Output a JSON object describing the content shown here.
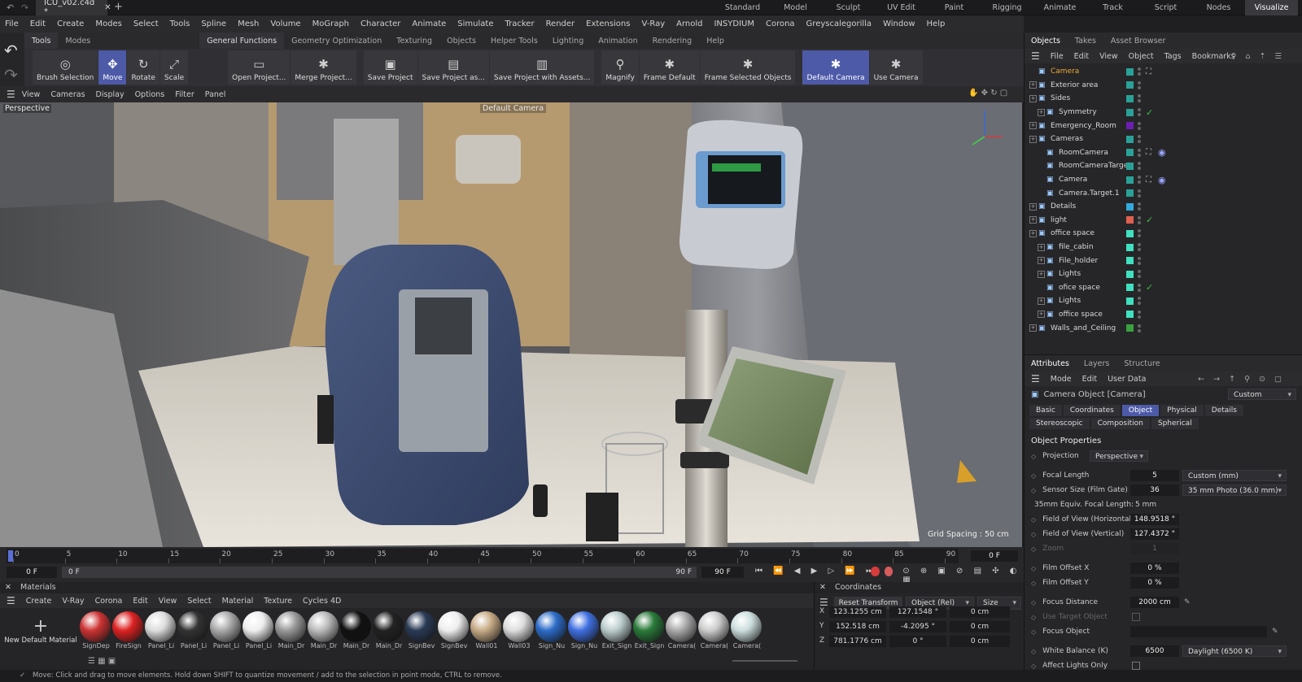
{
  "app": {
    "file_tab": "ICU_v02.c4d *",
    "layouts": [
      "Standard",
      "Model",
      "Sculpt",
      "UV Edit",
      "Paint",
      "Rigging",
      "Animate",
      "Track",
      "Script",
      "Nodes",
      "Visualize"
    ],
    "active_layout": "Visualize"
  },
  "menu": [
    "File",
    "Edit",
    "Create",
    "Modes",
    "Select",
    "Tools",
    "Spline",
    "Mesh",
    "Volume",
    "MoGraph",
    "Character",
    "Animate",
    "Simulate",
    "Tracker",
    "Render",
    "Extensions",
    "V-Ray",
    "Arnold",
    "INSYDIUM",
    "Corona",
    "Greyscalegorilla",
    "Window",
    "Help"
  ],
  "tool_tabs": {
    "left": [
      "Tools",
      "Modes"
    ],
    "right": [
      "General Functions",
      "Geometry Optimization",
      "Texturing",
      "Objects",
      "Helper Tools",
      "Lighting",
      "Animation",
      "Rendering",
      "Help"
    ],
    "active": "General Functions"
  },
  "toolbar": {
    "g1": [
      {
        "label": "Brush Selection",
        "icon": "◎"
      },
      {
        "label": "Move",
        "icon": "✥",
        "sel": true
      },
      {
        "label": "Rotate",
        "icon": "↻"
      },
      {
        "label": "Scale",
        "icon": "⤢"
      }
    ],
    "g2": [
      {
        "label": "Open Project...",
        "icon": "▭"
      },
      {
        "label": "Merge Project...",
        "icon": "✱"
      }
    ],
    "g3": [
      {
        "label": "Save Project",
        "icon": "▣"
      },
      {
        "label": "Save Project as...",
        "icon": "▤"
      },
      {
        "label": "Save Project with Assets...",
        "icon": "▥"
      }
    ],
    "g4": [
      {
        "label": "Magnify",
        "icon": "⚲"
      },
      {
        "label": "Frame Default",
        "icon": "✱"
      },
      {
        "label": "Frame Selected Objects",
        "icon": "✱"
      }
    ],
    "g5": [
      {
        "label": "Default Camera",
        "icon": "✱",
        "sel": true
      },
      {
        "label": "Use Camera",
        "icon": "✱"
      }
    ]
  },
  "viewport": {
    "menu": [
      "View",
      "Cameras",
      "Display",
      "Options",
      "Filter",
      "Panel"
    ],
    "mode": "Perspective",
    "camera": "Default Camera",
    "grid": "Grid Spacing : 50 cm"
  },
  "timeline": {
    "ticks": [
      "0",
      "5",
      "10",
      "15",
      "20",
      "25",
      "30",
      "35",
      "40",
      "45",
      "50",
      "55",
      "60",
      "65",
      "70",
      "75",
      "80",
      "85",
      "90"
    ],
    "current": "0 F",
    "start": "0 F",
    "start2": "0 F",
    "end": "90 F",
    "end2": "90 F"
  },
  "materials": {
    "title": "Materials",
    "menu": [
      "Create",
      "V-Ray",
      "Corona",
      "Edit",
      "View",
      "Select",
      "Material",
      "Texture",
      "Cycles 4D"
    ],
    "new_label": "New Default Material",
    "items": [
      {
        "n": "SignDep",
        "c": "#c33"
      },
      {
        "n": "FireSign",
        "c": "#d22"
      },
      {
        "n": "Panel_Li",
        "c": "#ddd"
      },
      {
        "n": "Panel_Li",
        "c": "#333"
      },
      {
        "n": "Panel_Li",
        "c": "#aaa"
      },
      {
        "n": "Panel_Li",
        "c": "#eee"
      },
      {
        "n": "Main_Dr",
        "c": "#999"
      },
      {
        "n": "Main_Dr",
        "c": "#bbb"
      },
      {
        "n": "Main_Dr",
        "c": "#111"
      },
      {
        "n": "Main_Dr",
        "c": "#222"
      },
      {
        "n": "SignBev",
        "c": "#2a3a55"
      },
      {
        "n": "SignBev",
        "c": "#eee"
      },
      {
        "n": "Wall01",
        "c": "#c7ab86"
      },
      {
        "n": "Wall03",
        "c": "#ddd"
      },
      {
        "n": "Sign_Nu",
        "c": "#2c6cc8"
      },
      {
        "n": "Sign_Nu",
        "c": "#3f6fe0"
      },
      {
        "n": "Exit_Sign",
        "c": "#bcc"
      },
      {
        "n": "Exit_Sign",
        "c": "#2a7a3a"
      },
      {
        "n": "Camera(",
        "c": "#aaa"
      },
      {
        "n": "Camera(",
        "c": "#ccc"
      },
      {
        "n": "Camera(",
        "c": "#cdd"
      }
    ]
  },
  "coords": {
    "title": "Coordinates",
    "reset": "Reset Transform",
    "mode": "Object (Rel)",
    "size": "Size",
    "rows": [
      {
        "axis": "X",
        "pos": "123.1255 cm",
        "rot": "127.1548 °",
        "sz": "0 cm"
      },
      {
        "axis": "Y",
        "pos": "152.518 cm",
        "rot": "-4.2095 °",
        "sz": "0 cm"
      },
      {
        "axis": "Z",
        "pos": "781.1776 cm",
        "rot": "0 °",
        "sz": "0 cm"
      }
    ]
  },
  "status": "Move: Click and drag to move elements. Hold down SHIFT to quantize movement / add to the selection in point mode, CTRL to remove.",
  "objects": {
    "tabs": [
      "Objects",
      "Takes",
      "Asset Browser"
    ],
    "menu": [
      "File",
      "Edit",
      "View",
      "Object",
      "Tags",
      "Bookmarks"
    ],
    "rows": [
      {
        "n": "Camera",
        "d": 0,
        "c": "#2aa198",
        "hl": true,
        "exp": false
      },
      {
        "n": "Exterior area",
        "d": 0,
        "c": "#2aa198",
        "exp": true
      },
      {
        "n": "Sides",
        "d": 0,
        "c": "#2aa198",
        "exp": true
      },
      {
        "n": "Symmetry",
        "d": 1,
        "c": "#2aa198",
        "exp": true,
        "check": true
      },
      {
        "n": "Emergency_Room",
        "d": 0,
        "c": "#6a1fb0",
        "exp": true
      },
      {
        "n": "Cameras",
        "d": 0,
        "c": "#2aa198",
        "exp": true
      },
      {
        "n": "RoomCamera",
        "d": 1,
        "c": "#2aa198",
        "target": true
      },
      {
        "n": "RoomCameraTarget",
        "d": 1,
        "c": "#2aa198"
      },
      {
        "n": "Camera",
        "d": 1,
        "c": "#2aa198",
        "target": true
      },
      {
        "n": "Camera.Target.1",
        "d": 1,
        "c": "#2aa198"
      },
      {
        "n": "Details",
        "d": 0,
        "c": "#33aadd",
        "exp": true
      },
      {
        "n": "light",
        "d": 0,
        "c": "#e06050",
        "exp": true,
        "check": true
      },
      {
        "n": "office space",
        "d": 0,
        "c": "#40e0c0",
        "exp": true
      },
      {
        "n": "file_cabin",
        "d": 1,
        "c": "#40e0c0",
        "exp": true
      },
      {
        "n": "File_holder",
        "d": 1,
        "c": "#40e0c0",
        "exp": true
      },
      {
        "n": "Lights",
        "d": 1,
        "c": "#40e0c0",
        "exp": true
      },
      {
        "n": "ofice space",
        "d": 1,
        "c": "#40e0c0",
        "check": true
      },
      {
        "n": "Lights",
        "d": 1,
        "c": "#40e0c0",
        "exp": true
      },
      {
        "n": "office space",
        "d": 1,
        "c": "#40e0c0",
        "exp": true
      },
      {
        "n": "Walls_and_Ceiling",
        "d": 0,
        "c": "#3aa040",
        "exp": true
      }
    ]
  },
  "attrs": {
    "tabs": [
      "Attributes",
      "Layers",
      "Structure"
    ],
    "menu": [
      "Mode",
      "Edit",
      "User Data"
    ],
    "object": "Camera Object [Camera]",
    "preset": "Custom",
    "btabs": [
      "Basic",
      "Coordinates",
      "Object",
      "Physical",
      "Details",
      "Stereoscopic",
      "Composition",
      "Spherical"
    ],
    "active_btab": "Object",
    "section": "Object Properties",
    "projection_label": "Projection",
    "projection": "Perspective",
    "focal_label": "Focal Length",
    "focal": "5",
    "focal_unit": "Custom (mm)",
    "sensor_label": "Sensor Size (Film Gate)",
    "sensor": "36",
    "sensor_unit": "35 mm Photo (36.0 mm)",
    "equiv": "35mm Equiv. Focal Length:",
    "equiv_val": "5 mm",
    "fovh_label": "Field of View (Horizontal)",
    "fovh": "148.9518 °",
    "fovv_label": "Field of View (Vertical)",
    "fovv": "127.4372 °",
    "zoom_label": "Zoom",
    "zoom": "1",
    "offx_label": "Film Offset X",
    "offx": "0 %",
    "offy_label": "Film Offset Y",
    "offy": "0 %",
    "fd_label": "Focus Distance",
    "fd": "2000 cm",
    "target_label": "Use Target Object",
    "fo_label": "Focus Object",
    "wb_label": "White Balance (K)",
    "wb": "6500",
    "wb_preset": "Daylight (6500 K)",
    "al_label": "Affect Lights Only"
  }
}
